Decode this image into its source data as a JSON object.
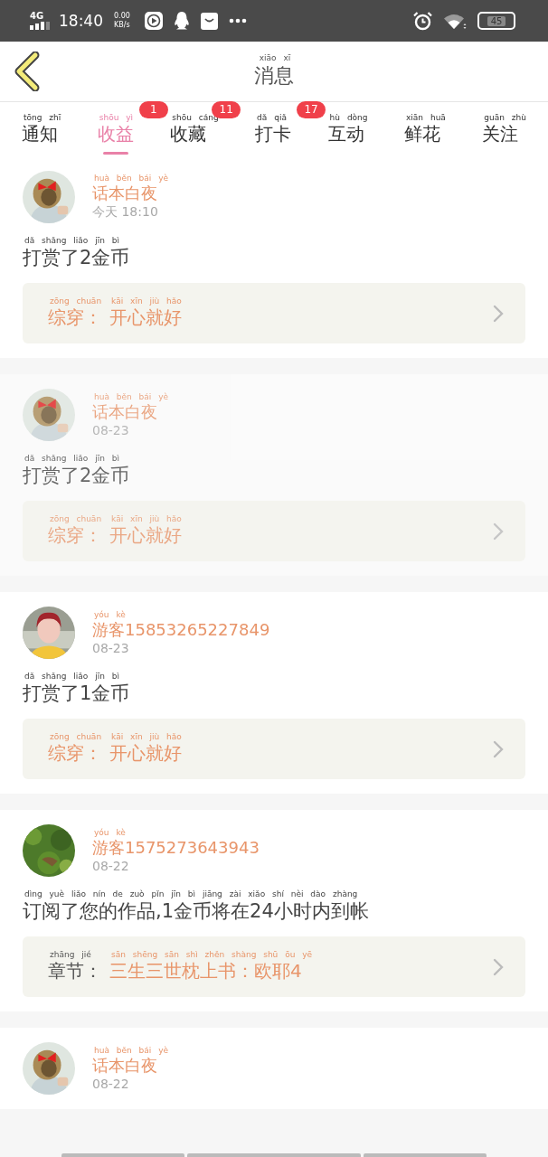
{
  "status_bar": {
    "network": "4G",
    "time": "18:40",
    "speed_value": "0.00",
    "speed_unit": "KB/s",
    "battery": "45"
  },
  "header": {
    "title": "消息",
    "title_pinyin": "xiāo xī"
  },
  "tabs": [
    {
      "label": "通知",
      "pinyin": "tōng zhī",
      "selected": false
    },
    {
      "label": "收益",
      "pinyin": "shōu yì",
      "selected": true,
      "badge": "1"
    },
    {
      "label": "收藏",
      "pinyin": "shōu cáng",
      "selected": false,
      "badge": "11"
    },
    {
      "label": "打卡",
      "pinyin": "dǎ qiǎ",
      "selected": false,
      "badge": "17"
    },
    {
      "label": "互动",
      "pinyin": "hù dòng",
      "selected": false
    },
    {
      "label": "鲜花",
      "pinyin": "xiān huā",
      "selected": false
    },
    {
      "label": "关注",
      "pinyin": "guān zhù",
      "selected": false
    }
  ],
  "messages": [
    {
      "dimmed": false,
      "name": "话本白夜",
      "name_pinyin": "huà běn bái yè",
      "time": "今天 18:10",
      "text": "打赏了2金币",
      "text_pinyin": "dǎ shǎng liǎo jīn bì",
      "ref": {
        "kind": "genre",
        "label": "综穿：",
        "label_pinyin": "zōng chuān",
        "value": "开心就好",
        "value_pinyin": "kāi xīn jiù hǎo"
      }
    },
    {
      "dimmed": true,
      "name": "话本白夜",
      "name_pinyin": "huà běn bái yè",
      "time": "08-23",
      "text": "打赏了2金币",
      "text_pinyin": "dǎ shǎng liǎo jīn bì",
      "ref": {
        "kind": "genre",
        "label": "综穿：",
        "label_pinyin": "zōng chuān",
        "value": "开心就好",
        "value_pinyin": "kāi xīn jiù hǎo"
      }
    },
    {
      "dimmed": false,
      "name": "游客15853265227849",
      "name_pinyin": "yóu kè",
      "time": "08-23",
      "text": "打赏了1金币",
      "text_pinyin": "dǎ shǎng liǎo jīn bì",
      "ref": {
        "kind": "genre",
        "label": "综穿：",
        "label_pinyin": "zōng chuān",
        "value": "开心就好",
        "value_pinyin": "kāi xīn jiù hǎo"
      }
    },
    {
      "dimmed": false,
      "name": "游客1575273643943",
      "name_pinyin": "yóu kè",
      "time": "08-22",
      "text": "订阅了您的作品,1金币将在24小时内到帐",
      "text_pinyin": "dìng yuè liǎo nín de zuò pǐn jīn bì jiāng zài xiǎo shí nèi dào zhàng",
      "ref": {
        "kind": "chapter",
        "label": "章节：",
        "label_pinyin": "zhāng jié",
        "value": "三生三世枕上书：欧耶4",
        "value_pinyin": "sān shēng sān shì zhěn shàng shū ōu yē"
      }
    },
    {
      "dimmed": false,
      "name": "话本白夜",
      "name_pinyin": "huà běn bái yè",
      "time": "08-22"
    }
  ]
}
